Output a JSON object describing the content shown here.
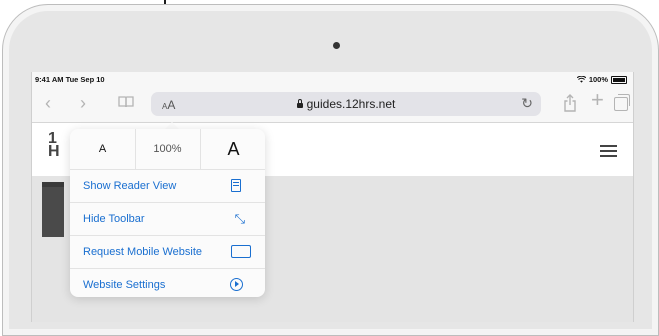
{
  "status_bar": {
    "time_date": "9:41 AM  Tue Sep 10",
    "wifi_icon": "wifi-icon",
    "battery": "100%"
  },
  "toolbar": {
    "back_icon": "chevron-left-icon",
    "forward_icon": "chevron-right-icon",
    "bookmarks_icon": "book-icon",
    "aa_small": "A",
    "aa_large": "A",
    "url": "guides.12hrs.net",
    "reload_icon": "reload-icon",
    "share_icon": "share-icon",
    "plus_label": "+",
    "tabs_icon": "tabs-icon"
  },
  "page": {
    "logo_line1": "1",
    "logo_line2": "H"
  },
  "popover": {
    "font_small": "A",
    "zoom": "100%",
    "font_large": "A",
    "items": [
      {
        "label": "Show Reader View",
        "icon": "reader-icon"
      },
      {
        "label": "Hide Toolbar",
        "icon": "resize-icon"
      },
      {
        "label": "Request Mobile Website",
        "icon": "device-icon"
      },
      {
        "label": "Website Settings",
        "icon": "settings-icon"
      }
    ]
  },
  "colors": {
    "accent": "#1a6fd0",
    "toolbar_bg": "#f7f7f7",
    "url_bg": "#e3e3e8"
  }
}
